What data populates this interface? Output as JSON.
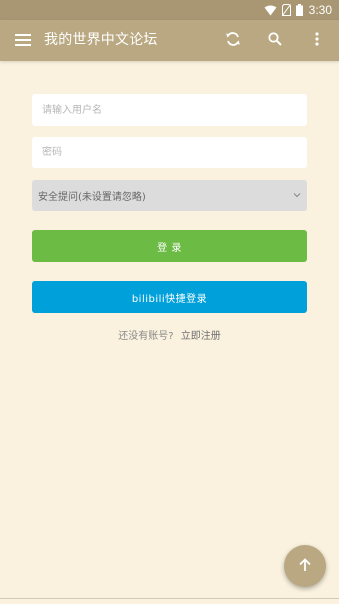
{
  "status_bar": {
    "time": "3:30",
    "icons": [
      "wifi-icon",
      "no-sim-icon",
      "battery-icon"
    ]
  },
  "app_bar": {
    "title": "我的世界中文论坛",
    "icons": [
      "menu-icon",
      "refresh-icon",
      "search-icon",
      "more-vert-icon"
    ],
    "background": "#b9a881"
  },
  "form": {
    "username_placeholder": "请输入用户名",
    "password_placeholder": "密码",
    "security_question": "安全提问(未设置请忽略)",
    "login_label": "登 录",
    "bilibili_label": "bilibili快捷登录",
    "no_account_text": "还没有账号?",
    "register_link": "立即注册"
  },
  "colors": {
    "page_background": "#faf2df",
    "login_button": "#6bbb45",
    "bilibili_button": "#00a0da",
    "accent": "#b9a881"
  },
  "fab": {
    "icon": "arrow-up-icon"
  }
}
